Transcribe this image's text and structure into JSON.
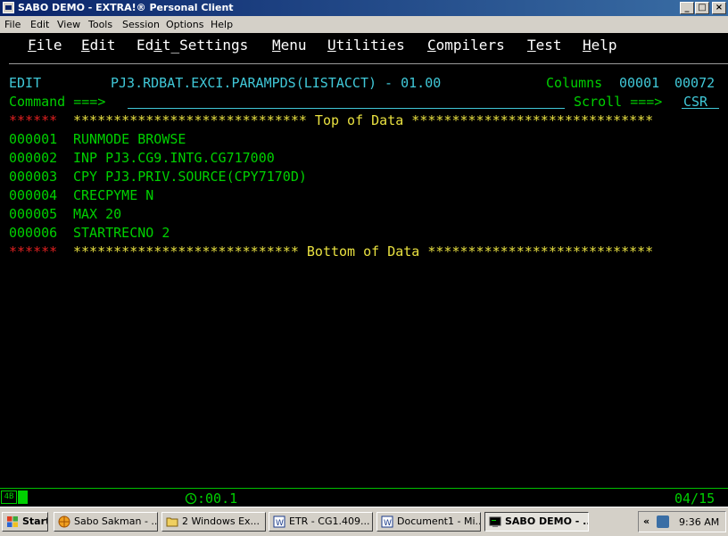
{
  "window": {
    "title": "SABO DEMO - EXTRA!® Personal Client",
    "controls": {
      "minimize": "_",
      "maximize": "□",
      "close": "×"
    }
  },
  "app_menu": [
    "File",
    "Edit",
    "View",
    "Tools",
    "Session",
    "Options",
    "Help"
  ],
  "ispf_menu": [
    {
      "pre": "",
      "hot": "F",
      "post": "ile"
    },
    {
      "pre": "",
      "hot": "E",
      "post": "dit"
    },
    {
      "pre": "Ed",
      "hot": "i",
      "post": "t_Settings"
    },
    {
      "pre": "",
      "hot": "M",
      "post": "enu"
    },
    {
      "pre": "",
      "hot": "U",
      "post": "tilities"
    },
    {
      "pre": "",
      "hot": "C",
      "post": "ompilers"
    },
    {
      "pre": "",
      "hot": "T",
      "post": "est"
    },
    {
      "pre": "",
      "hot": "H",
      "post": "elp"
    }
  ],
  "header": {
    "mode": "EDIT",
    "dataset": "PJ3.RDBAT.EXCI.PARAMPDS(LISTACCT) - 01.00",
    "columns_label": "Columns",
    "columns_start": "00001",
    "columns_end": "00072",
    "command_label": "Command ===>",
    "command_value": "",
    "scroll_label": "Scroll ===>",
    "scroll_value": "CSR"
  },
  "top_marker": {
    "prefix": "******",
    "text": "***************************** Top of Data ******************************"
  },
  "lines": [
    {
      "num": "000001",
      "text": "RUNMODE BROWSE"
    },
    {
      "num": "000002",
      "text": "INP PJ3.CG9.INTG.CG717000"
    },
    {
      "num": "000003",
      "text": "CPY PJ3.PRIV.SOURCE(CPY7170D)"
    },
    {
      "num": "000004",
      "text": "CRECPYME N"
    },
    {
      "num": "000005",
      "text": "MAX 20"
    },
    {
      "num": "000006",
      "text": "STARTRECNO 2"
    }
  ],
  "bottom_marker": {
    "prefix": "******",
    "text": "**************************** Bottom of Data ****************************"
  },
  "status": {
    "indicator": "4B",
    "clock_icon": "clock-icon",
    "clock": ":00.1",
    "cursor_pos": "04/15"
  },
  "taskbar": {
    "start": "Start",
    "buttons": [
      {
        "label": "Sabo Sakman - ...",
        "icon": "browser-icon"
      },
      {
        "label": "2 Windows Ex...",
        "icon": "folder-icon"
      },
      {
        "label": "ETR - CG1.409...",
        "icon": "word-icon"
      },
      {
        "label": "Document1 - Mi...",
        "icon": "word-icon"
      },
      {
        "label": "SABO DEMO - ...",
        "icon": "terminal-icon",
        "active": true
      }
    ],
    "tray_chevron": "«",
    "time": "9:36 AM"
  }
}
